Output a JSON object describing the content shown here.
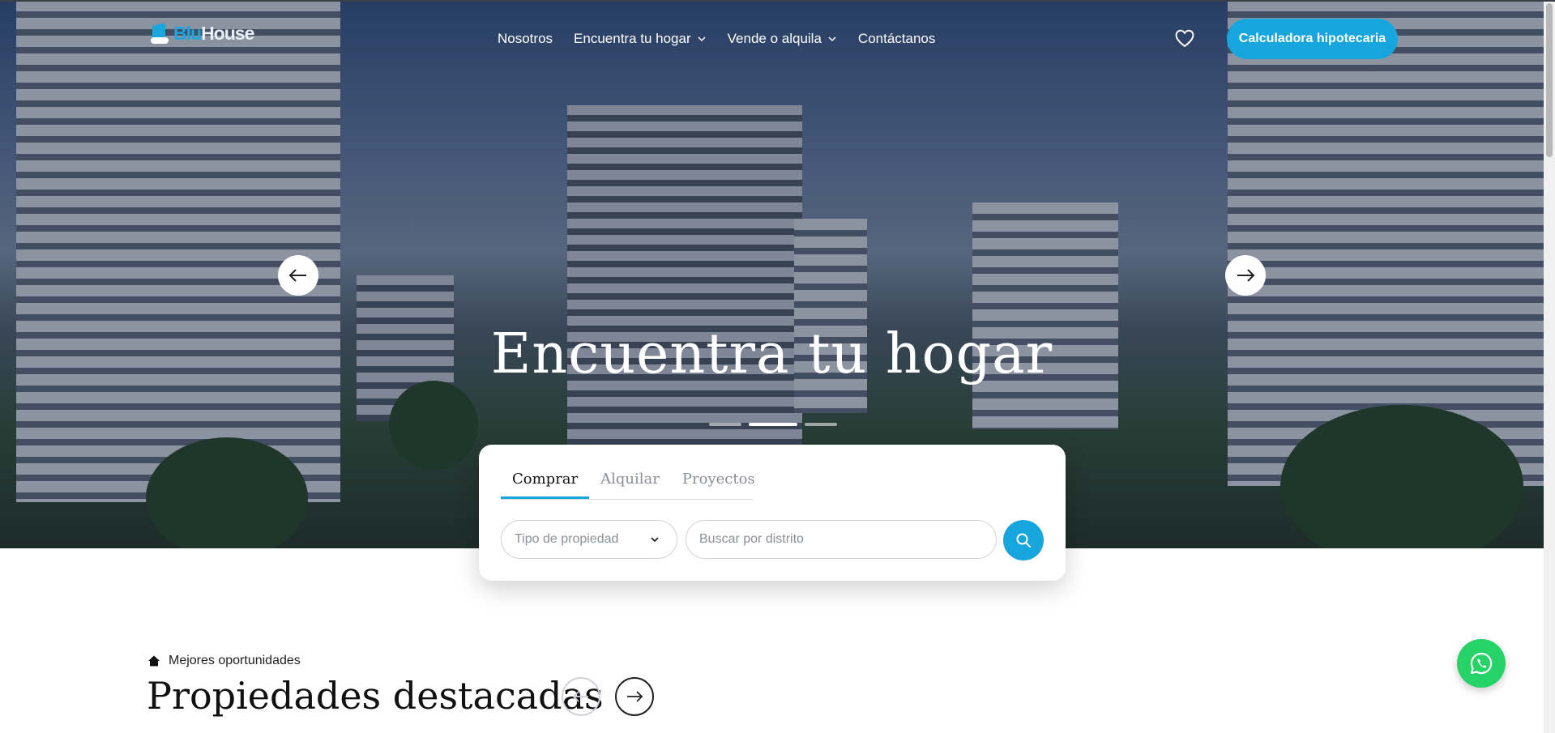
{
  "brand": {
    "logo_part1": "Blu",
    "logo_part2": "House",
    "accent_color": "#16a6dd",
    "whatsapp_color": "#25d366"
  },
  "nav": {
    "items": [
      {
        "label": "Nosotros",
        "has_dropdown": false
      },
      {
        "label": "Encuentra tu hogar",
        "has_dropdown": true
      },
      {
        "label": "Vende o alquila",
        "has_dropdown": true
      },
      {
        "label": "Contáctanos",
        "has_dropdown": false
      }
    ],
    "favorites_icon": "heart-icon",
    "cta_label": "Calculadora hipotecaria"
  },
  "hero": {
    "title": "Encuentra tu hogar",
    "slide_count": 3,
    "active_slide": 2,
    "prev_icon": "arrow-left-icon",
    "next_icon": "arrow-right-icon"
  },
  "search": {
    "tabs": [
      {
        "label": "Comprar",
        "active": true
      },
      {
        "label": "Alquilar",
        "active": false
      },
      {
        "label": "Proyectos",
        "active": false
      }
    ],
    "property_type_placeholder": "Tipo de propiedad",
    "district_placeholder": "Buscar por distrito",
    "search_icon": "search-icon"
  },
  "featured": {
    "eyebrow": "Mejores oportunidades",
    "title": "Propiedades destacadas"
  }
}
